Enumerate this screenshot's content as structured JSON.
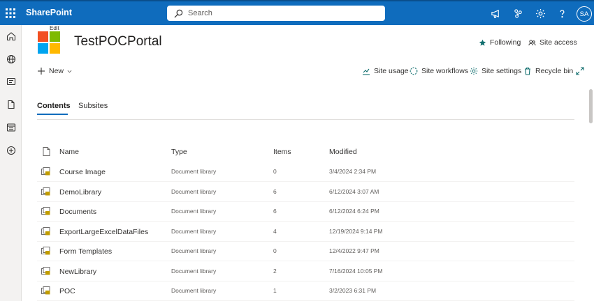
{
  "suite": {
    "brand": "SharePoint",
    "search_placeholder": "Search",
    "avatar_initials": "SA"
  },
  "site": {
    "edit_label": "Edit",
    "title": "TestPOCPortal",
    "following_label": "Following",
    "site_access_label": "Site access"
  },
  "commands": {
    "new_label": "New",
    "site_usage": "Site usage",
    "site_workflows": "Site workflows",
    "site_settings": "Site settings",
    "recycle_bin": "Recycle bin"
  },
  "tabs": [
    {
      "label": "Contents",
      "active": true
    },
    {
      "label": "Subsites",
      "active": false
    }
  ],
  "table": {
    "columns": [
      "Name",
      "Type",
      "Items",
      "Modified"
    ],
    "rows": [
      {
        "name": "Course Image",
        "type": "Document library",
        "items": "0",
        "modified": "3/4/2024 2:34 PM"
      },
      {
        "name": "DemoLibrary",
        "type": "Document library",
        "items": "6",
        "modified": "6/12/2024 3:07 AM"
      },
      {
        "name": "Documents",
        "type": "Document library",
        "items": "6",
        "modified": "6/12/2024 6:24 PM"
      },
      {
        "name": "ExportLargeExcelDataFiles",
        "type": "Document library",
        "items": "4",
        "modified": "12/19/2024 9:14 PM"
      },
      {
        "name": "Form Templates",
        "type": "Document library",
        "items": "0",
        "modified": "12/4/2022 9:47 PM"
      },
      {
        "name": "NewLibrary",
        "type": "Document library",
        "items": "2",
        "modified": "7/16/2024 10:05 PM"
      },
      {
        "name": "POC",
        "type": "Document library",
        "items": "1",
        "modified": "3/2/2023 6:31 PM"
      }
    ]
  },
  "colors": {
    "suite_bar": "#0f6cbd",
    "accent": "#0f6cbd",
    "logo": [
      "#f25022",
      "#7fba00",
      "#00a4ef",
      "#ffb900"
    ]
  },
  "icons": {
    "appbar": [
      "home-icon",
      "globe-icon",
      "news-icon",
      "document-icon",
      "list-icon",
      "add-circle-icon"
    ],
    "suitebar": [
      "megaphone-icon",
      "network-icon",
      "gear-icon",
      "help-icon"
    ]
  }
}
